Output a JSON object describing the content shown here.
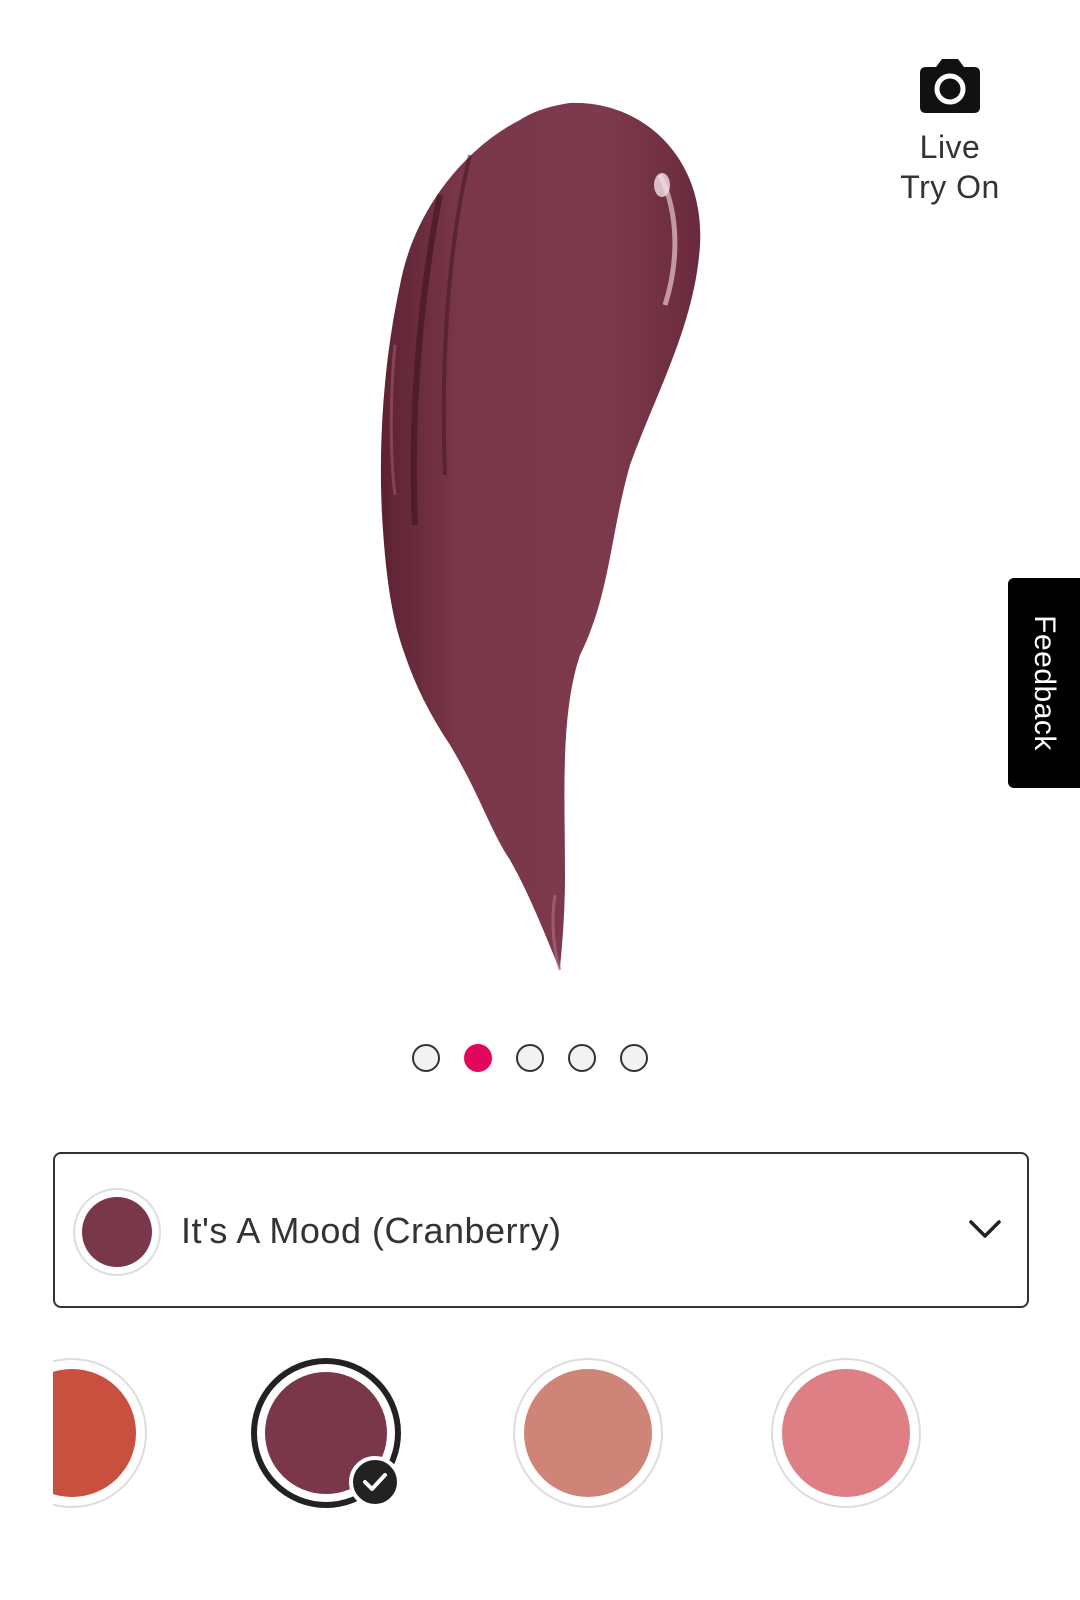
{
  "live_try_on": {
    "line1": "Live",
    "line2": "Try On",
    "icon": "camera-icon"
  },
  "feedback": {
    "label": "Feedback"
  },
  "carousel": {
    "total": 5,
    "active_index": 1
  },
  "shade_selector": {
    "selected_name": "It's A Mood (Cranberry)",
    "selected_color": "#7a3749",
    "icon": "chevron-down-icon"
  },
  "swatches": [
    {
      "color": "#c94f3e",
      "selected": false
    },
    {
      "color": "#7a3749",
      "selected": true
    },
    {
      "color": "#cf8478",
      "selected": false
    },
    {
      "color": "#de7f86",
      "selected": false
    }
  ],
  "colors": {
    "accent": "#e2075c",
    "lipstick": "#7a3749"
  }
}
